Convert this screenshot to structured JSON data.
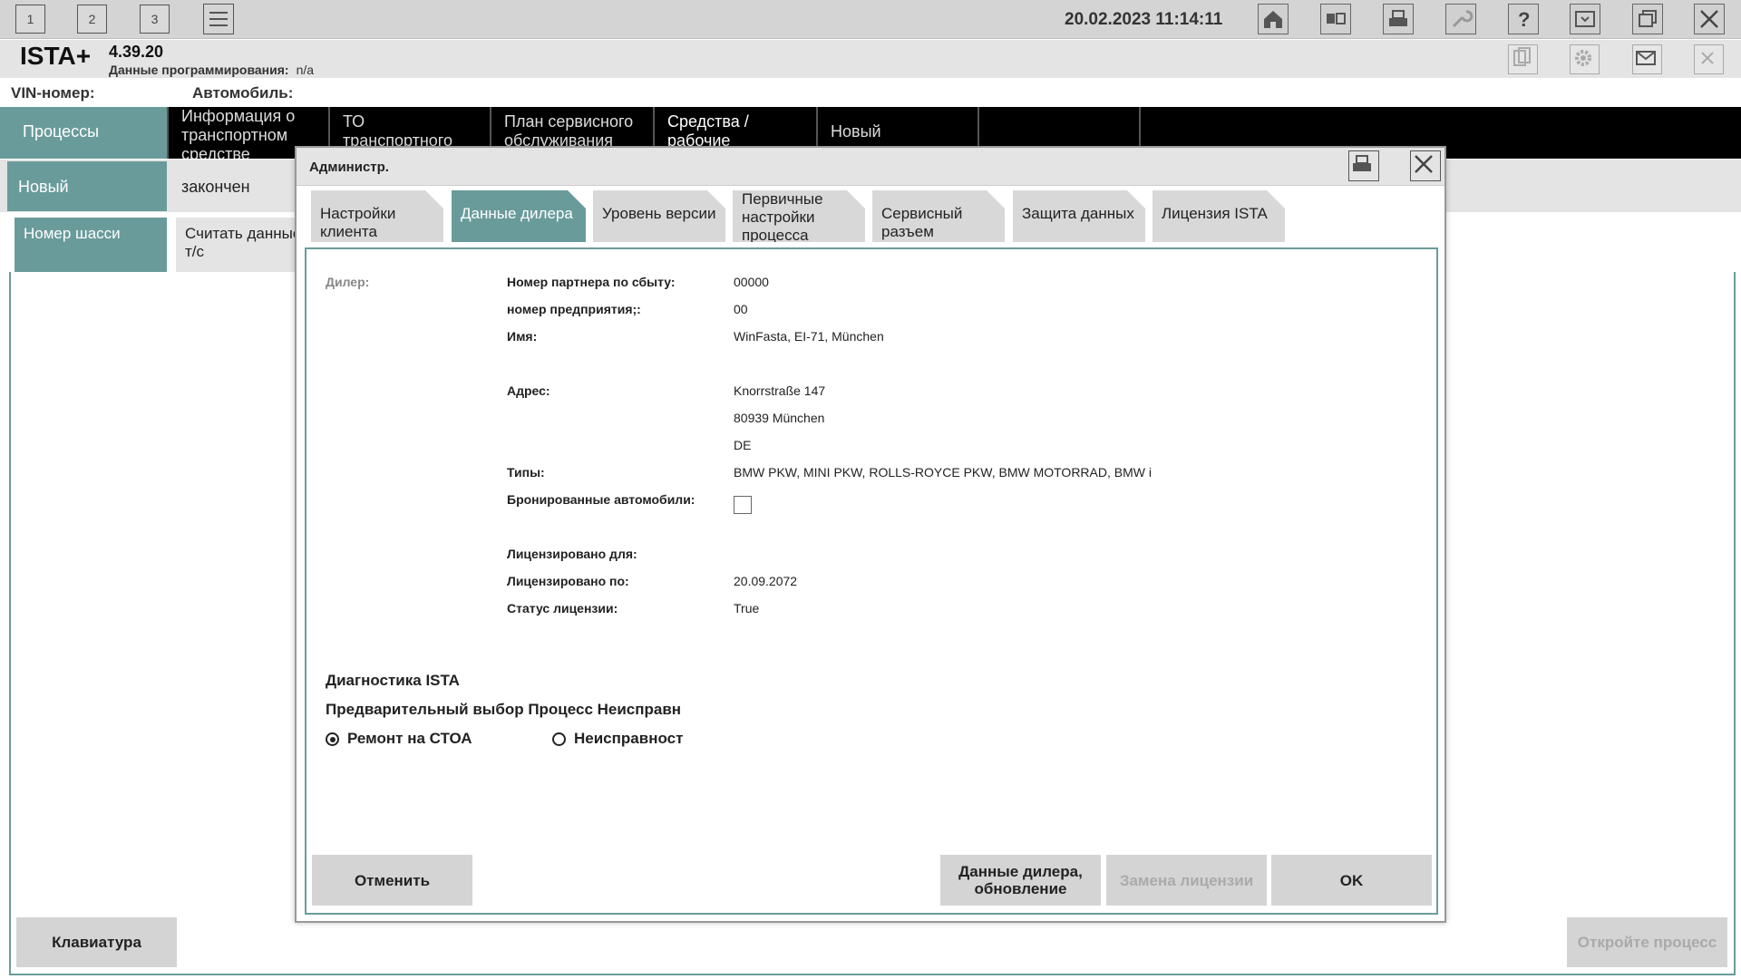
{
  "topbar": {
    "workspaces": [
      "1",
      "2",
      "3"
    ],
    "datetime": "20.02.2023 11:14:11",
    "icons": [
      "list-icon",
      "home-icon",
      "compare-icon",
      "print-icon",
      "wrench-icon",
      "help-icon",
      "dropdown-window-icon",
      "restore-window-icon",
      "close-icon"
    ]
  },
  "app": {
    "name": "ISTA+",
    "version": "4.39.20",
    "programming_data_label": "Данные программирования:",
    "programming_data_value": "n/a"
  },
  "vehicle": {
    "vin_label": "VIN-номер:",
    "car_label": "Автомобиль:"
  },
  "main_nav": [
    "Процессы",
    "Информация о транспортном средстве",
    "ТО транспортного средства",
    "План сервисного обслуживания",
    "Средства / рабочие жидкости",
    "Новый"
  ],
  "sub_nav": [
    "Новый",
    "закончен"
  ],
  "third_nav": [
    "Номер шасси",
    "Считать данные т/с"
  ],
  "main_buttons": {
    "keyboard": "Клавиатура",
    "open_process": "Откройте процесс"
  },
  "dialog": {
    "title": "Администр.",
    "tabs": [
      "Настройки клиента",
      "Данные дилера",
      "Уровень версии",
      "Первичные настройки процесса",
      "Сервисный разъем",
      "Защита данных",
      "Лицензия ISTA"
    ],
    "dealer_label": "Дилер:",
    "fields": {
      "partner_no_label": "Номер партнера по сбыту:",
      "partner_no_value": "00000",
      "company_no_label": "номер предприятия;:",
      "company_no_value": "00",
      "name_label": "Имя:",
      "name_value": "WinFasta, EI-71, München",
      "address_label": "Адрес:",
      "address_line1": "Knorrstraße 147",
      "address_line2": "80939 München",
      "address_line3": "DE",
      "types_label": "Типы:",
      "types_value": "BMW PKW, MINI PKW, ROLLS-ROYCE PKW, BMW MOTORRAD, BMW i",
      "reserved_label": "Бронированные автомобили:",
      "licensed_for_label": "Лицензировано для:",
      "licensed_until_label": "Лицензировано по:",
      "licensed_until_value": "20.09.2072",
      "license_status_label": "Статус лицензии:",
      "license_status_value": "True"
    },
    "diag_section": "Диагностика ISTA",
    "preselect_label": "Предварительный выбор Процесс Неисправн",
    "radio_repair": "Ремонт на СТОА",
    "radio_fault": "Неисправност",
    "buttons": {
      "cancel": "Отменить",
      "update_dealer": "Данные дилера, обновление",
      "replace_license": "Замена лицензии",
      "ok": "OK"
    }
  }
}
